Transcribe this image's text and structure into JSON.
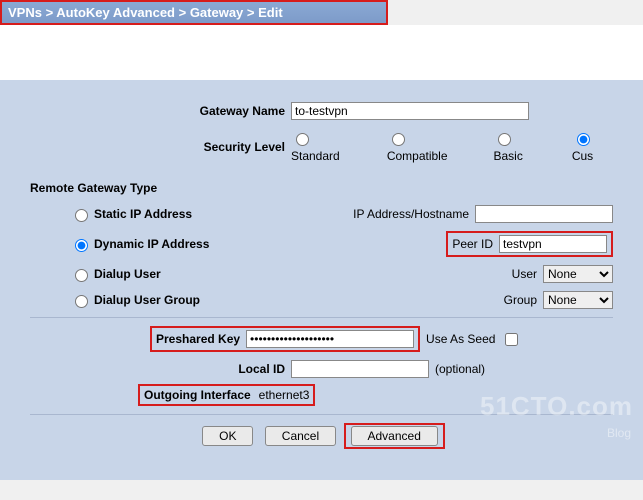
{
  "breadcrumb": "VPNs > AutoKey Advanced > Gateway > Edit",
  "fields": {
    "gateway_name_label": "Gateway Name",
    "gateway_name_value": "to-testvpn",
    "security_level_label": "Security Level",
    "security_options": {
      "standard": "Standard",
      "compatible": "Compatible",
      "basic": "Basic",
      "custom": "Cus"
    },
    "security_selected": "custom",
    "remote_type_title": "Remote Gateway Type",
    "remote_types": {
      "static_ip": "Static IP Address",
      "dynamic_ip": "Dynamic IP Address",
      "dialup_user": "Dialup User",
      "dialup_group": "Dialup User Group"
    },
    "remote_selected": "dynamic_ip",
    "ip_hostname_label": "IP Address/Hostname",
    "ip_hostname_value": "",
    "peer_id_label": "Peer ID",
    "peer_id_value": "testvpn",
    "user_label": "User",
    "user_value": "None",
    "group_label": "Group",
    "group_value": "None",
    "preshared_key_label": "Preshared Key",
    "preshared_key_value": "••••••••••••••••••••",
    "use_as_seed_label": "Use As Seed",
    "local_id_label": "Local ID",
    "local_id_value": "",
    "local_id_hint": "(optional)",
    "outgoing_if_label": "Outgoing Interface",
    "outgoing_if_value": "ethernet3"
  },
  "buttons": {
    "ok": "OK",
    "cancel": "Cancel",
    "advanced": "Advanced"
  },
  "colors": {
    "highlight": "#d61c1c",
    "panel_bg": "#c8d5e8"
  },
  "watermark": {
    "main": "51CTO.com",
    "sub": "Blog"
  }
}
